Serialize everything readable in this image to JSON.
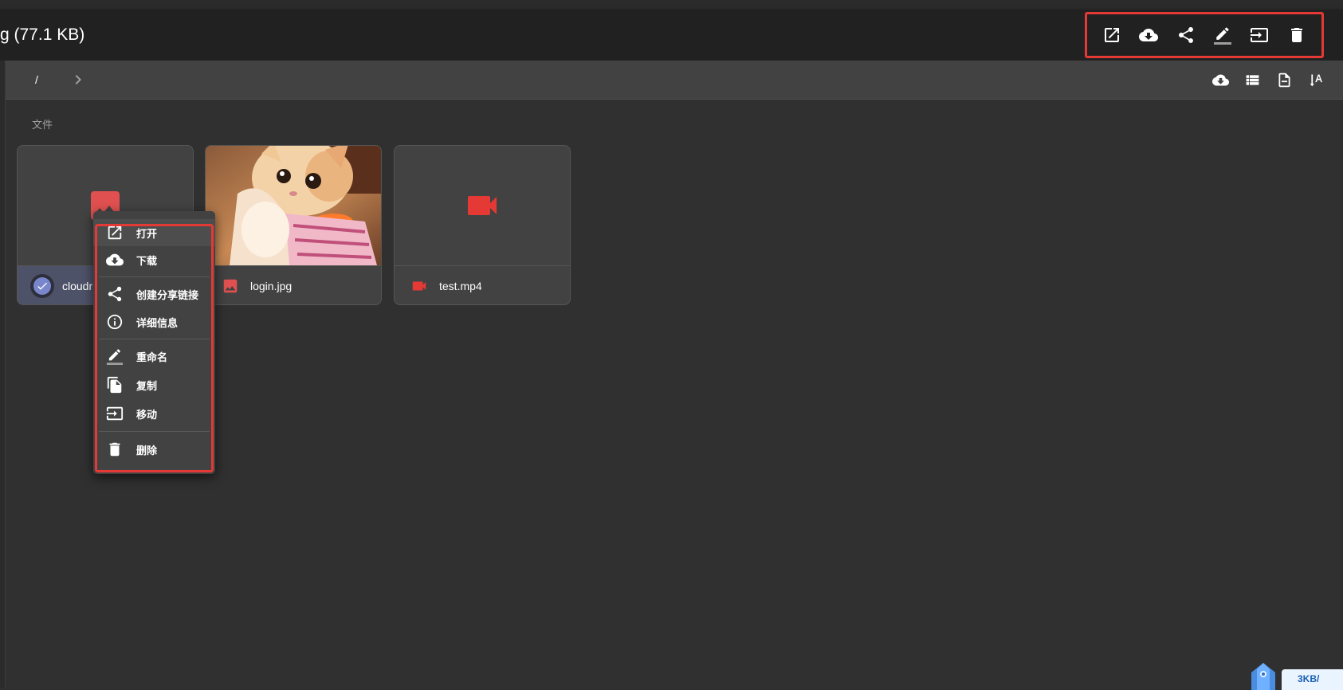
{
  "selection_bar": {
    "title": "g (77.1 KB)",
    "actions": [
      {
        "name": "open",
        "icon": "open-in-new-icon"
      },
      {
        "name": "download",
        "icon": "cloud-download-icon"
      },
      {
        "name": "share",
        "icon": "share-icon"
      },
      {
        "name": "rename",
        "icon": "pencil-icon"
      },
      {
        "name": "move",
        "icon": "move-to-icon"
      },
      {
        "name": "delete",
        "icon": "trash-icon"
      }
    ]
  },
  "navbar": {
    "root_label": "/",
    "right_icons": [
      "cloud-download-icon",
      "list-view-icon",
      "file-settings-icon",
      "sort-icon"
    ]
  },
  "section_label": "文件",
  "files": [
    {
      "name": "cloudr",
      "icon": "image-icon",
      "icon_color": "#e05050",
      "selected": true
    },
    {
      "name": "login.jpg",
      "icon": "image-icon",
      "icon_color": "#e05050",
      "selected": false
    },
    {
      "name": "test.mp4",
      "icon": "video-icon",
      "icon_color": "#e53935",
      "selected": false
    }
  ],
  "context_menu": {
    "items": [
      {
        "label": "打开",
        "icon": "open-in-new-icon"
      },
      {
        "label": "下载",
        "icon": "cloud-download-icon"
      },
      {
        "label": "创建分享链接",
        "icon": "share-icon"
      },
      {
        "label": "详细信息",
        "icon": "info-icon"
      },
      {
        "label": "重命名",
        "icon": "pencil-icon"
      },
      {
        "label": "复制",
        "icon": "copy-icon"
      },
      {
        "label": "移动",
        "icon": "move-to-icon"
      },
      {
        "label": "删除",
        "icon": "trash-icon"
      }
    ]
  },
  "accent_colors": {
    "highlight_border": "#e53935",
    "selected_check": "#7986cb"
  },
  "floating_widget": {
    "text": "3KB/"
  }
}
